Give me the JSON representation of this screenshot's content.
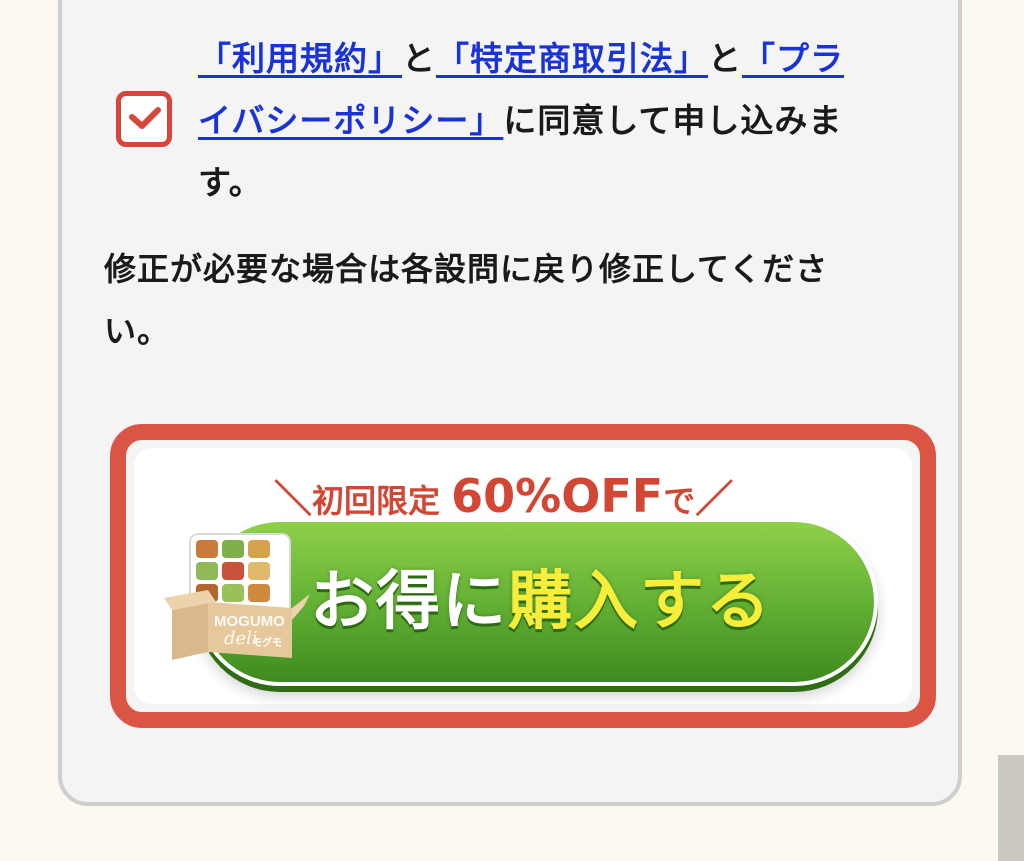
{
  "consent": {
    "checked": true,
    "link_terms": "「利用規約」",
    "conj1": "と",
    "link_commerce": "「特定商取引法」",
    "conj2": "と",
    "link_privacy_a": "「プラ",
    "link_privacy_b": "イバシーポリシー」",
    "tail_a": "に同意して申し込みま",
    "tail_b": "す。"
  },
  "note": {
    "line1": "修正が必要な場合は各設問に戻り修正してくださ",
    "line2": "い。"
  },
  "cta": {
    "promo_prefix": "＼",
    "promo_label": "初回限定",
    "promo_value": "60%OFF",
    "promo_suffix_text": "で",
    "promo_suffix": "／",
    "main_white": "お得に",
    "main_yellow": "購入する",
    "product_brand": "MOGUMO",
    "product_sub": "deli",
    "product_kana": "モグモ"
  },
  "colors": {
    "accent_red": "#db5544",
    "link_blue": "#1a33d6",
    "cta_green": "#5fae32",
    "cta_yellow": "#f6ee3a"
  }
}
